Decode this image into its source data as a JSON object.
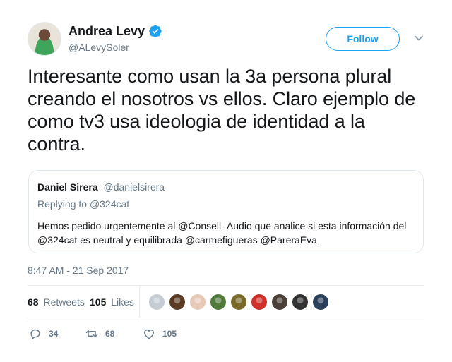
{
  "tweet": {
    "author": {
      "name": "Andrea Levy",
      "handle": "@ALevySoler",
      "verified": true
    },
    "follow_label": "Follow",
    "text": "Interesante como usan la 3a persona plural creando el nosotros vs ellos. Claro ejemplo de como tv3 usa ideologia de identidad a la contra.",
    "timestamp": "8:47 AM - 21 Sep 2017"
  },
  "quoted_tweet": {
    "author_name": "Daniel Sirera",
    "author_handle": "@danielsirera",
    "replying_prefix": "Replying to",
    "replying_to": "@324cat",
    "text": "Hemos pedido urgentemente al @Consell_Audio que analice si esta información del @324cat es neutral y equilibrada @carmefigueras @PareraEva"
  },
  "stats": {
    "retweets_count": "68",
    "retweets_label": "Retweets",
    "likes_count": "105",
    "likes_label": "Likes",
    "liker_avatars": [
      {
        "icon": "avatar-default",
        "color": "#c5ccd3"
      },
      {
        "icon": "avatar-1",
        "color": "#5a3a22"
      },
      {
        "icon": "avatar-2",
        "color": "#e8c9b8"
      },
      {
        "icon": "avatar-3",
        "color": "#4f7a3a"
      },
      {
        "icon": "avatar-4",
        "color": "#7a6a2a"
      },
      {
        "icon": "avatar-5",
        "color": "#d0302a"
      },
      {
        "icon": "avatar-6",
        "color": "#4a4038"
      },
      {
        "icon": "avatar-7",
        "color": "#333333"
      },
      {
        "icon": "avatar-8",
        "color": "#2a3f5a"
      }
    ]
  },
  "actions": {
    "reply_count": "34",
    "retweet_count": "68",
    "like_count": "105"
  },
  "colors": {
    "accent": "#1da1f2",
    "text": "#14171a",
    "secondary": "#657786",
    "border": "#e6ecf0"
  }
}
